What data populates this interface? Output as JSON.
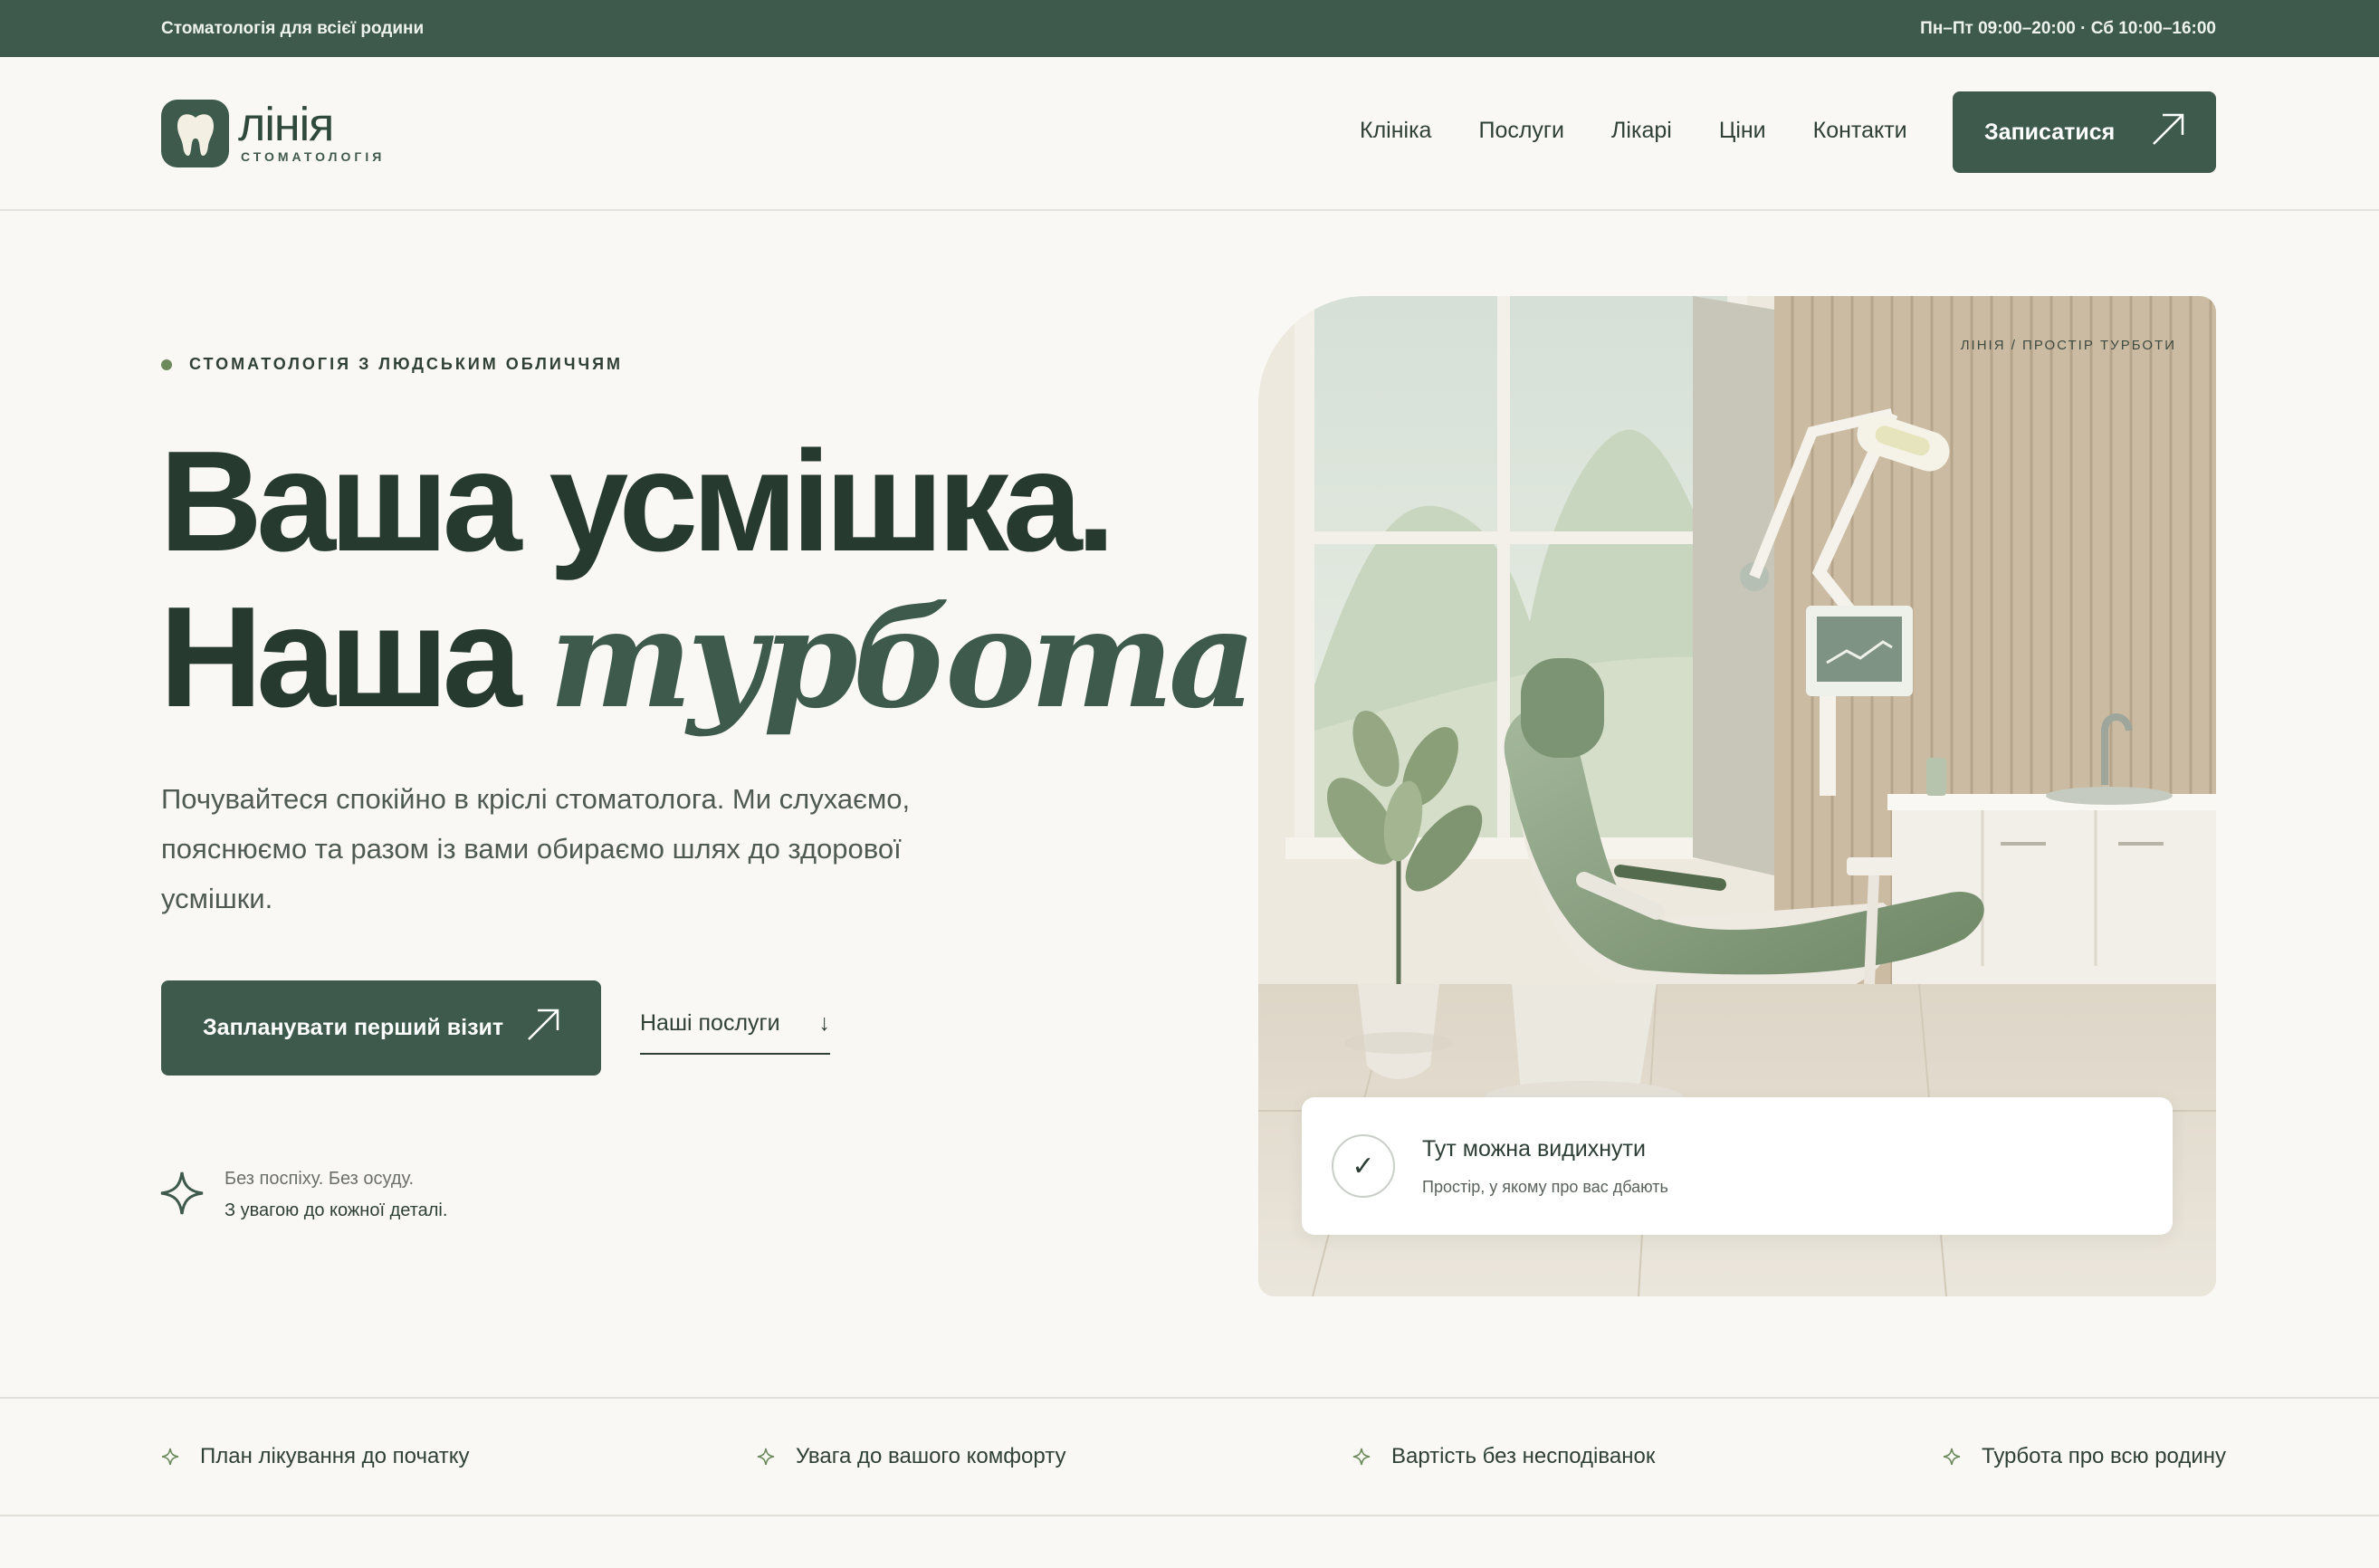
{
  "topbar": {
    "tagline": "Стоматологія для всієї родини",
    "hours": "Пн–Пт 09:00–20:00 · Сб 10:00–16:00"
  },
  "brand": {
    "name": "лінія",
    "subtitle": "СТОМАТОЛОГІЯ",
    "logo_icon": "tooth-icon"
  },
  "nav": {
    "items": [
      {
        "label": "Клініка"
      },
      {
        "label": "Послуги"
      },
      {
        "label": "Лікарі"
      },
      {
        "label": "Ціни"
      },
      {
        "label": "Контакти"
      }
    ],
    "cta_label": "Записатися",
    "cta_icon": "arrow-up-right-icon"
  },
  "hero": {
    "eyebrow": "СТОМАТОЛОГІЯ З ЛЮДСЬКИМ ОБЛИЧЧЯМ",
    "title_line1": "Ваша усмішка.",
    "title_line2_start": "Наша ",
    "title_line2_emphasis": "турбота.",
    "lead": "Почувайтеся спокійно в кріслі стоматолога. Ми слухаємо, пояснюємо та разом із вами обираємо шлях до здорової усмішки.",
    "primary_label": "Запланувати перший візит",
    "primary_icon": "arrow-up-right-icon",
    "secondary_label": "Наші послуги",
    "secondary_arrow": "↓",
    "secondary_icon": "arrow-down-icon",
    "note_line1": "Без поспіху. Без осуду.",
    "note_line2": "З увагою до кожної деталі.",
    "note_icon": "sparkle-icon"
  },
  "illustration": {
    "tag": "ЛІНІЯ / ПРОСТІР ТУРБОТИ",
    "card_title": "Тут можна видихнути",
    "card_subtitle": "Простір, у якому про вас дбають",
    "card_check": "✓",
    "card_icon": "check-icon"
  },
  "features": [
    {
      "label": "План лікування до початку",
      "icon": "sparkle-icon"
    },
    {
      "label": "Увага до вашого комфорту",
      "icon": "sparkle-icon"
    },
    {
      "label": "Вартість без несподіванок",
      "icon": "sparkle-icon"
    },
    {
      "label": "Турбота про всю родину",
      "icon": "sparkle-icon"
    }
  ],
  "colors": {
    "brand_green": "#3d5a4c",
    "background": "#faf8f4",
    "accent_sage": "#6c8a5c",
    "text_dark": "#263a30"
  }
}
